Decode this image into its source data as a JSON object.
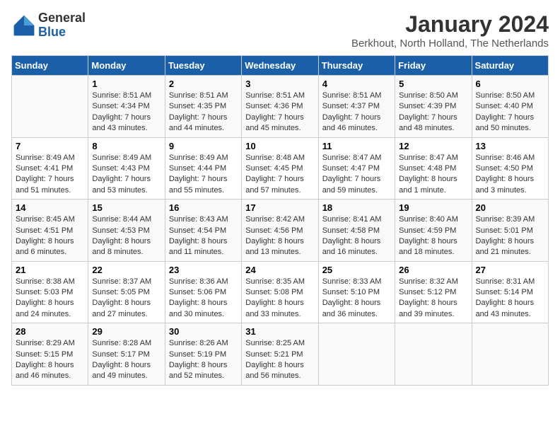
{
  "logo": {
    "general": "General",
    "blue": "Blue"
  },
  "header": {
    "title": "January 2024",
    "subtitle": "Berkhout, North Holland, The Netherlands"
  },
  "weekdays": [
    "Sunday",
    "Monday",
    "Tuesday",
    "Wednesday",
    "Thursday",
    "Friday",
    "Saturday"
  ],
  "weeks": [
    [
      {
        "day": "",
        "sunrise": "",
        "sunset": "",
        "daylight": ""
      },
      {
        "day": "1",
        "sunrise": "Sunrise: 8:51 AM",
        "sunset": "Sunset: 4:34 PM",
        "daylight": "Daylight: 7 hours and 43 minutes."
      },
      {
        "day": "2",
        "sunrise": "Sunrise: 8:51 AM",
        "sunset": "Sunset: 4:35 PM",
        "daylight": "Daylight: 7 hours and 44 minutes."
      },
      {
        "day": "3",
        "sunrise": "Sunrise: 8:51 AM",
        "sunset": "Sunset: 4:36 PM",
        "daylight": "Daylight: 7 hours and 45 minutes."
      },
      {
        "day": "4",
        "sunrise": "Sunrise: 8:51 AM",
        "sunset": "Sunset: 4:37 PM",
        "daylight": "Daylight: 7 hours and 46 minutes."
      },
      {
        "day": "5",
        "sunrise": "Sunrise: 8:50 AM",
        "sunset": "Sunset: 4:39 PM",
        "daylight": "Daylight: 7 hours and 48 minutes."
      },
      {
        "day": "6",
        "sunrise": "Sunrise: 8:50 AM",
        "sunset": "Sunset: 4:40 PM",
        "daylight": "Daylight: 7 hours and 50 minutes."
      }
    ],
    [
      {
        "day": "7",
        "sunrise": "Sunrise: 8:49 AM",
        "sunset": "Sunset: 4:41 PM",
        "daylight": "Daylight: 7 hours and 51 minutes."
      },
      {
        "day": "8",
        "sunrise": "Sunrise: 8:49 AM",
        "sunset": "Sunset: 4:43 PM",
        "daylight": "Daylight: 7 hours and 53 minutes."
      },
      {
        "day": "9",
        "sunrise": "Sunrise: 8:49 AM",
        "sunset": "Sunset: 4:44 PM",
        "daylight": "Daylight: 7 hours and 55 minutes."
      },
      {
        "day": "10",
        "sunrise": "Sunrise: 8:48 AM",
        "sunset": "Sunset: 4:45 PM",
        "daylight": "Daylight: 7 hours and 57 minutes."
      },
      {
        "day": "11",
        "sunrise": "Sunrise: 8:47 AM",
        "sunset": "Sunset: 4:47 PM",
        "daylight": "Daylight: 7 hours and 59 minutes."
      },
      {
        "day": "12",
        "sunrise": "Sunrise: 8:47 AM",
        "sunset": "Sunset: 4:48 PM",
        "daylight": "Daylight: 8 hours and 1 minute."
      },
      {
        "day": "13",
        "sunrise": "Sunrise: 8:46 AM",
        "sunset": "Sunset: 4:50 PM",
        "daylight": "Daylight: 8 hours and 3 minutes."
      }
    ],
    [
      {
        "day": "14",
        "sunrise": "Sunrise: 8:45 AM",
        "sunset": "Sunset: 4:51 PM",
        "daylight": "Daylight: 8 hours and 6 minutes."
      },
      {
        "day": "15",
        "sunrise": "Sunrise: 8:44 AM",
        "sunset": "Sunset: 4:53 PM",
        "daylight": "Daylight: 8 hours and 8 minutes."
      },
      {
        "day": "16",
        "sunrise": "Sunrise: 8:43 AM",
        "sunset": "Sunset: 4:54 PM",
        "daylight": "Daylight: 8 hours and 11 minutes."
      },
      {
        "day": "17",
        "sunrise": "Sunrise: 8:42 AM",
        "sunset": "Sunset: 4:56 PM",
        "daylight": "Daylight: 8 hours and 13 minutes."
      },
      {
        "day": "18",
        "sunrise": "Sunrise: 8:41 AM",
        "sunset": "Sunset: 4:58 PM",
        "daylight": "Daylight: 8 hours and 16 minutes."
      },
      {
        "day": "19",
        "sunrise": "Sunrise: 8:40 AM",
        "sunset": "Sunset: 4:59 PM",
        "daylight": "Daylight: 8 hours and 18 minutes."
      },
      {
        "day": "20",
        "sunrise": "Sunrise: 8:39 AM",
        "sunset": "Sunset: 5:01 PM",
        "daylight": "Daylight: 8 hours and 21 minutes."
      }
    ],
    [
      {
        "day": "21",
        "sunrise": "Sunrise: 8:38 AM",
        "sunset": "Sunset: 5:03 PM",
        "daylight": "Daylight: 8 hours and 24 minutes."
      },
      {
        "day": "22",
        "sunrise": "Sunrise: 8:37 AM",
        "sunset": "Sunset: 5:05 PM",
        "daylight": "Daylight: 8 hours and 27 minutes."
      },
      {
        "day": "23",
        "sunrise": "Sunrise: 8:36 AM",
        "sunset": "Sunset: 5:06 PM",
        "daylight": "Daylight: 8 hours and 30 minutes."
      },
      {
        "day": "24",
        "sunrise": "Sunrise: 8:35 AM",
        "sunset": "Sunset: 5:08 PM",
        "daylight": "Daylight: 8 hours and 33 minutes."
      },
      {
        "day": "25",
        "sunrise": "Sunrise: 8:33 AM",
        "sunset": "Sunset: 5:10 PM",
        "daylight": "Daylight: 8 hours and 36 minutes."
      },
      {
        "day": "26",
        "sunrise": "Sunrise: 8:32 AM",
        "sunset": "Sunset: 5:12 PM",
        "daylight": "Daylight: 8 hours and 39 minutes."
      },
      {
        "day": "27",
        "sunrise": "Sunrise: 8:31 AM",
        "sunset": "Sunset: 5:14 PM",
        "daylight": "Daylight: 8 hours and 43 minutes."
      }
    ],
    [
      {
        "day": "28",
        "sunrise": "Sunrise: 8:29 AM",
        "sunset": "Sunset: 5:15 PM",
        "daylight": "Daylight: 8 hours and 46 minutes."
      },
      {
        "day": "29",
        "sunrise": "Sunrise: 8:28 AM",
        "sunset": "Sunset: 5:17 PM",
        "daylight": "Daylight: 8 hours and 49 minutes."
      },
      {
        "day": "30",
        "sunrise": "Sunrise: 8:26 AM",
        "sunset": "Sunset: 5:19 PM",
        "daylight": "Daylight: 8 hours and 52 minutes."
      },
      {
        "day": "31",
        "sunrise": "Sunrise: 8:25 AM",
        "sunset": "Sunset: 5:21 PM",
        "daylight": "Daylight: 8 hours and 56 minutes."
      },
      {
        "day": "",
        "sunrise": "",
        "sunset": "",
        "daylight": ""
      },
      {
        "day": "",
        "sunrise": "",
        "sunset": "",
        "daylight": ""
      },
      {
        "day": "",
        "sunrise": "",
        "sunset": "",
        "daylight": ""
      }
    ]
  ]
}
